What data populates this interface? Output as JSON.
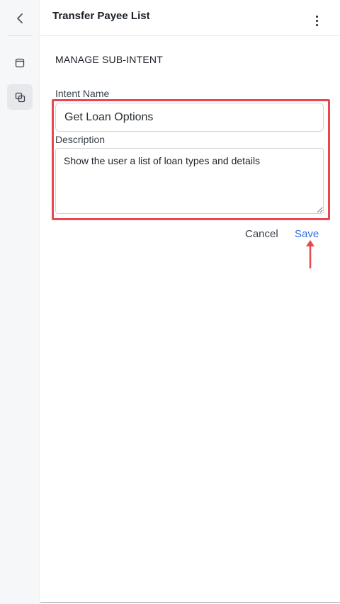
{
  "header": {
    "title": "Transfer Payee List"
  },
  "section": {
    "title": "MANAGE SUB-INTENT"
  },
  "form": {
    "intent_name_label": "Intent Name",
    "intent_name_value": "Get Loan Options",
    "description_label": "Description",
    "description_value": "Show the user a list of loan types and details"
  },
  "actions": {
    "cancel_label": "Cancel",
    "save_label": "Save"
  },
  "icons": {
    "back": "chevron-left-icon",
    "rail_item_1": "window-icon",
    "rail_item_2": "copy-icon",
    "more": "more-vertical-icon"
  },
  "colors": {
    "accent": "#2d6fdc",
    "highlight": "#e8474e",
    "rail_bg": "#f6f7f9"
  }
}
